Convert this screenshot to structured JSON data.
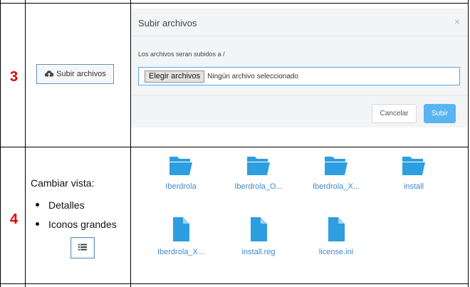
{
  "rows": [
    {
      "number": "3"
    },
    {
      "number": "4"
    }
  ],
  "upload_button": {
    "label": "Subir archivos",
    "icon": "cloud-upload-icon"
  },
  "modal": {
    "title": "Subir archivos",
    "close": "×",
    "upload_path_text": "Los archivos seran subidos a /",
    "choose_button": "Elegir archivos",
    "no_file_text": "Ningún archivo seleccionado",
    "cancel_label": "Cancelar",
    "submit_label": "Subir"
  },
  "view_switch": {
    "title": "Cambiar vista:",
    "options": [
      "Detalles",
      "Iconos grandes"
    ],
    "button_icon": "list-view-icon"
  },
  "files": [
    {
      "name": "Iberdrola",
      "type": "folder"
    },
    {
      "name": "Iberdrola_O...",
      "type": "folder"
    },
    {
      "name": "Iberdrola_X...",
      "type": "folder"
    },
    {
      "name": "install",
      "type": "folder"
    },
    {
      "name": "Iberdrola_X...",
      "type": "file"
    },
    {
      "name": "install.reg",
      "type": "file"
    },
    {
      "name": "license.ini",
      "type": "file"
    }
  ],
  "colors": {
    "accent": "#2d9ee0",
    "link": "#3f88cf",
    "submit": "#5ab4f2",
    "row_number": "#e00000"
  }
}
